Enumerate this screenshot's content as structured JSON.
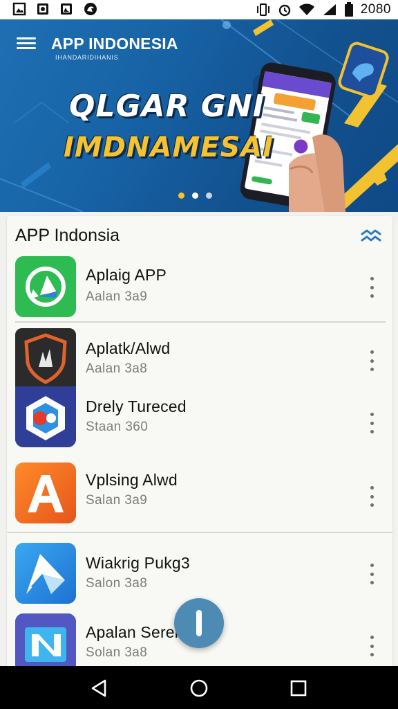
{
  "status_bar": {
    "time": "2080",
    "left_icons": [
      "image-icon",
      "photo-icon",
      "gallery-icon",
      "app-notification-icon"
    ],
    "right_icons": [
      "vibrate-icon",
      "alarm-icon",
      "wifi-icon",
      "signal-icon",
      "battery-icon"
    ]
  },
  "header": {
    "title": "APP INDONESIA",
    "subtitle": "IHANDARIDIHANIS"
  },
  "banner": {
    "headline_line1": "QLGAR GNI",
    "headline_line2": "IMDNAMESAI",
    "dots": 3,
    "active_dot": 1
  },
  "section": {
    "title": "APP Indonsia"
  },
  "apps": [
    {
      "name": "Aplaig APP",
      "sub": "Aalan 3a9",
      "icon": "chat-arrow-icon",
      "color": "#27b24a"
    },
    {
      "name": "Aplatk/Alwd",
      "sub": "Aalan 3a8",
      "icon": "shield-emblem-icon",
      "color": "#2b2b2b"
    },
    {
      "name": "Drely Tureced",
      "sub": "Staan 360",
      "icon": "hexagon-puzzle-icon",
      "color": "#2b3f8e"
    },
    {
      "name": "Vplsing Alwd",
      "sub": "Salan 3a9",
      "icon": "letter-a-icon",
      "color": "#f06a1e"
    },
    {
      "name": "Wiakrig  Pukg3",
      "sub": "Salon 3a8",
      "icon": "paper-plane-icon",
      "color": "#2a8ee0"
    },
    {
      "name": "Apalan Serel",
      "sub": "Solan 3a8",
      "icon": "puzzle-n-icon",
      "color": "#4f53b8"
    }
  ],
  "colors": {
    "hero_blue": "#1763a6",
    "accent_gold": "#f2c230",
    "fab": "#4d8bb4"
  },
  "nav": {
    "buttons": [
      "back-icon",
      "home-icon",
      "recents-icon"
    ]
  }
}
